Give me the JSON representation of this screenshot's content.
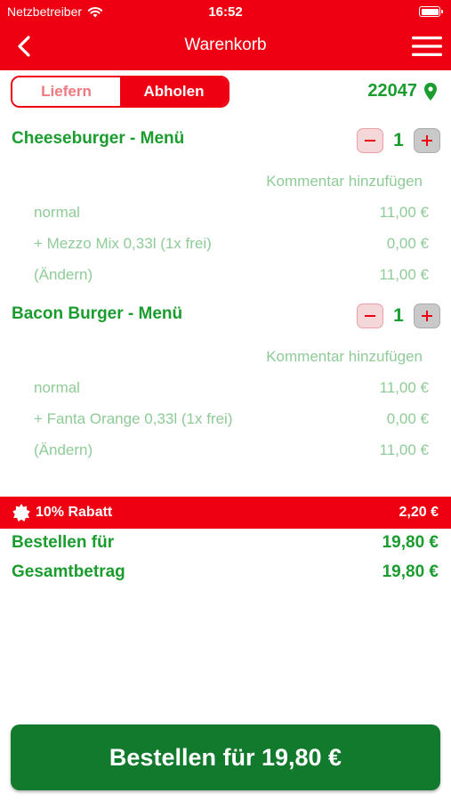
{
  "status_bar": {
    "carrier": "Netzbetreiber",
    "time": "16:52"
  },
  "nav": {
    "title": "Warenkorb",
    "back_icon": "chevron-left-icon",
    "menu_icon": "hamburger-menu-icon"
  },
  "mode": {
    "deliver_label": "Liefern",
    "pickup_label": "Abholen",
    "selected": "Abholen"
  },
  "location": {
    "zip": "22047",
    "icon": "location-pin-icon"
  },
  "items": [
    {
      "name": "Cheeseburger - Menü",
      "quantity": "1",
      "comment_label": "Kommentar hinzufügen",
      "lines": [
        {
          "label": "normal",
          "price": "11,00 €"
        },
        {
          "label": "+ Mezzo Mix 0,33l (1x frei)",
          "price": "0,00 €"
        },
        {
          "label": "(Ändern)",
          "price": "11,00 €"
        }
      ]
    },
    {
      "name": "Bacon Burger - Menü",
      "quantity": "1",
      "comment_label": "Kommentar hinzufügen",
      "lines": [
        {
          "label": "normal",
          "price": "11,00 €"
        },
        {
          "label": "+ Fanta Orange 0,33l (1x frei)",
          "price": "0,00 €"
        },
        {
          "label": "(Ändern)",
          "price": "11,00 €"
        }
      ]
    }
  ],
  "discount": {
    "label": "10% Rabatt",
    "amount": "2,20 €"
  },
  "summary": {
    "order_for_label": "Bestellen für",
    "order_for_value": "19,80 €",
    "total_label": "Gesamtbetrag",
    "total_value": "19,80 €"
  },
  "order_button": {
    "label": "Bestellen für 19,80 €"
  },
  "colors": {
    "brand_red": "#ee0012",
    "green": "#1a9d2e",
    "button_green": "#127a2c",
    "light_green": "#8fcb97"
  }
}
